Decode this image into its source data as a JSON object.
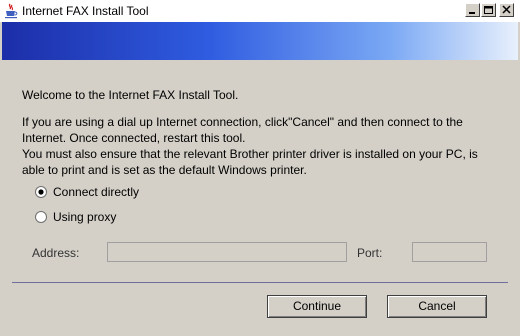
{
  "window": {
    "title": "Internet FAX Install Tool",
    "icons": {
      "app": "java-cup-icon",
      "minimize": "minimize-icon",
      "maximize": "maximize-icon",
      "close": "close-icon"
    }
  },
  "banner": {
    "gradient_colors": [
      "#1c2ea8",
      "#2f5ce0",
      "#7aa8f4",
      "#e8f0fc"
    ]
  },
  "body": {
    "welcome": "Welcome to the Internet FAX Install Tool.",
    "paragraph_lines": [
      "If you are using a dial up Internet connection, click\"Cancel\" and then connect to the",
      "Internet. Once connected, restart this tool.",
      "You must also ensure that the relevant Brother printer driver is installed on your PC, is",
      "able to print and is set as the default Windows printer."
    ]
  },
  "connection": {
    "options": [
      {
        "label": "Connect directly",
        "selected": true
      },
      {
        "label": "Using proxy",
        "selected": false
      }
    ],
    "address_label": "Address:",
    "address_value": "",
    "port_label": "Port:",
    "port_value": ""
  },
  "buttons": {
    "continue": "Continue",
    "cancel": "Cancel"
  }
}
